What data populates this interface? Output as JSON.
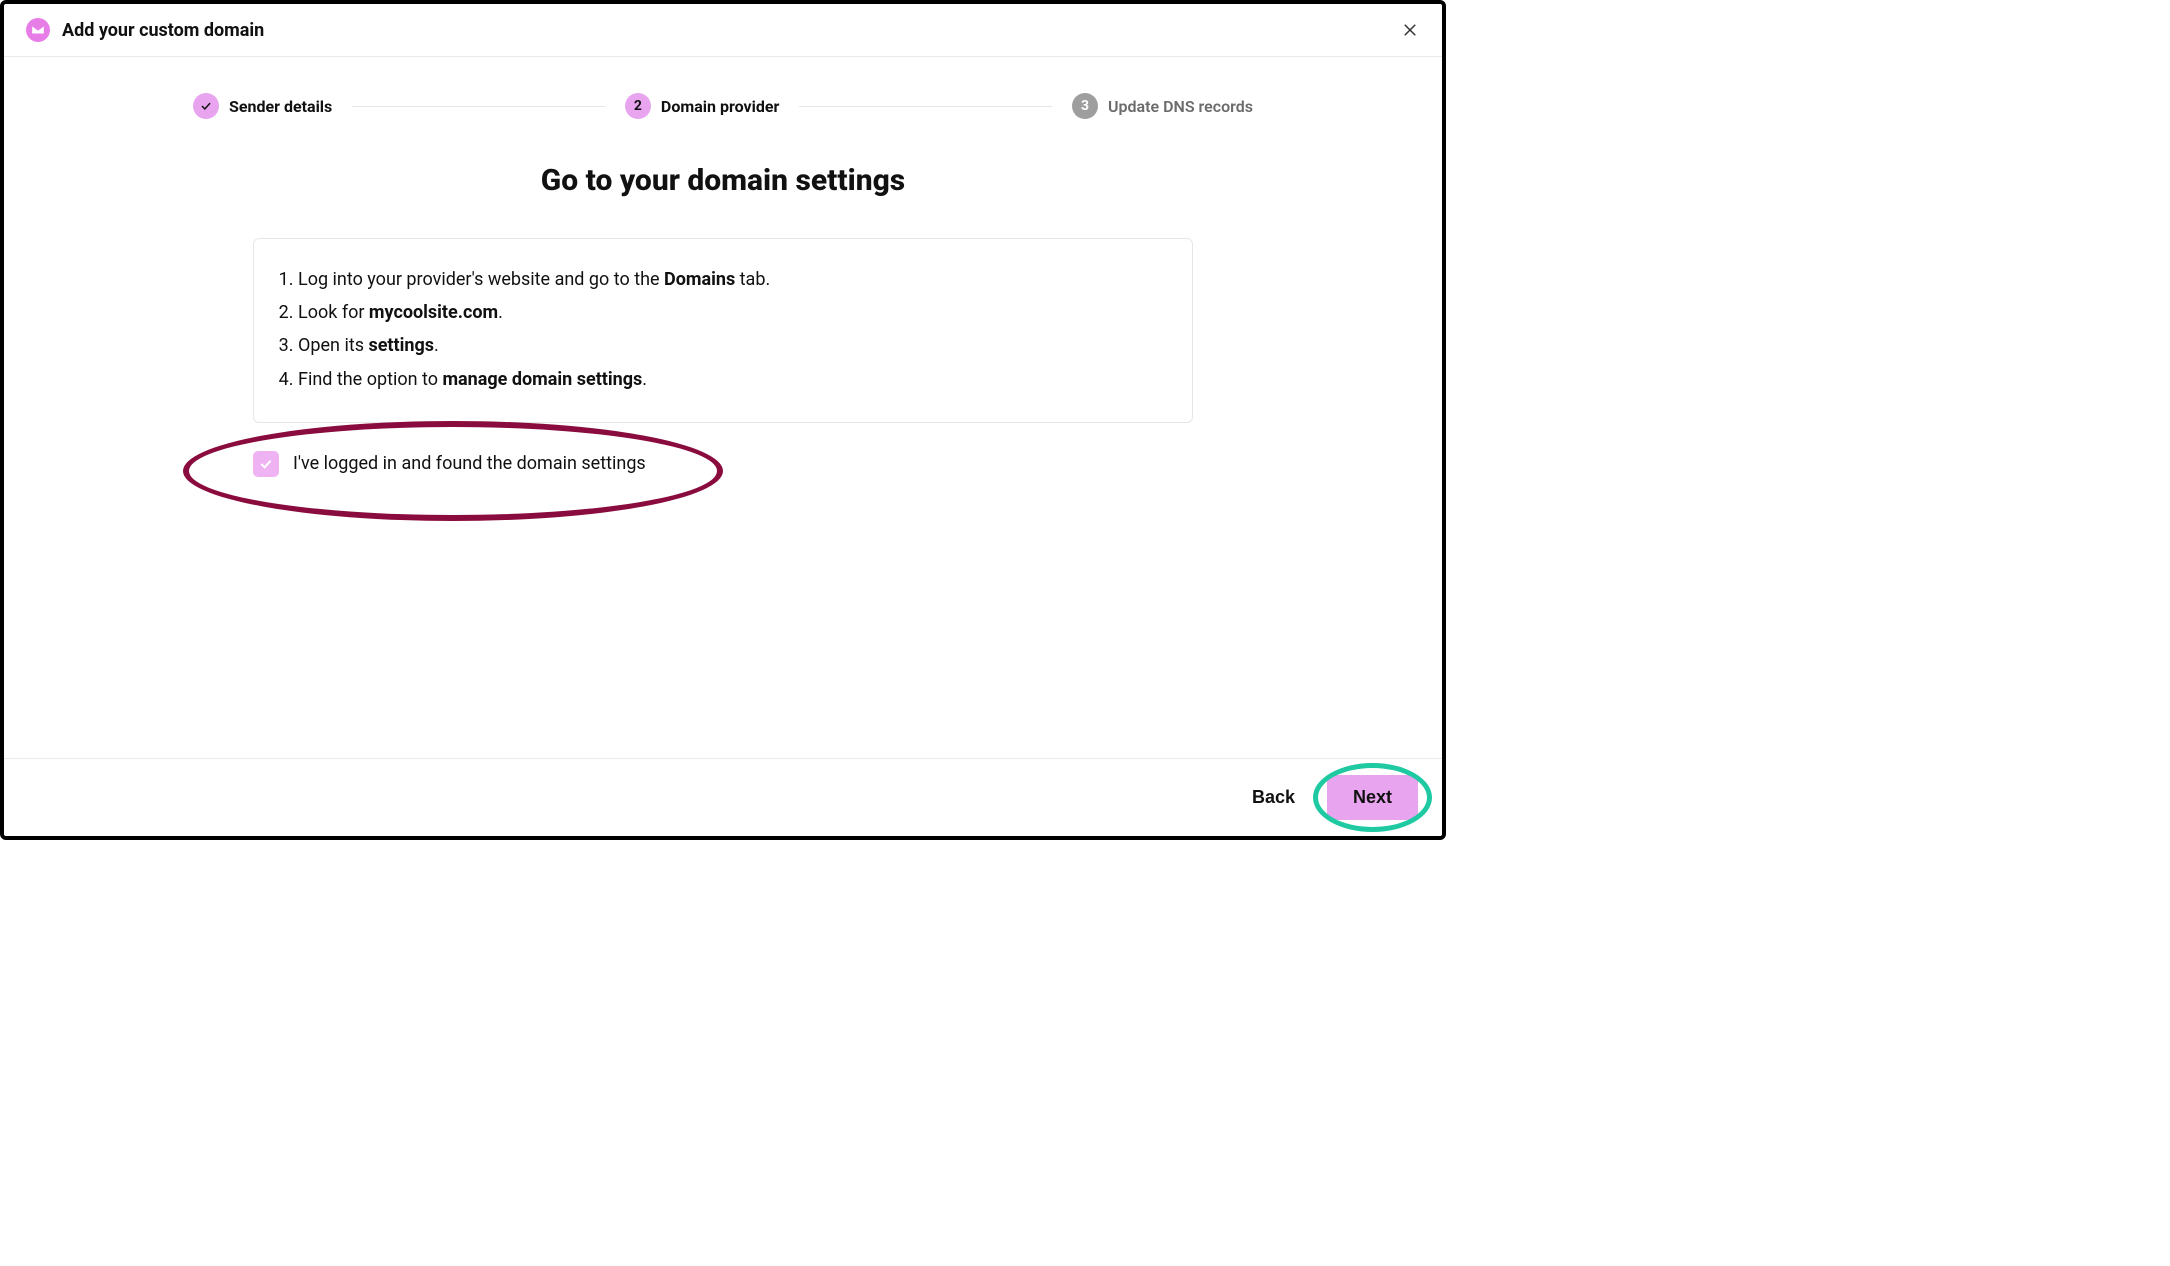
{
  "header": {
    "title": "Add your custom domain"
  },
  "stepper": {
    "steps": [
      {
        "label": "Sender details",
        "state": "done"
      },
      {
        "label": "Domain provider",
        "state": "active",
        "num": "2"
      },
      {
        "label": "Update DNS records",
        "state": "pending",
        "num": "3"
      }
    ]
  },
  "page": {
    "title": "Go to your domain settings"
  },
  "instructions": {
    "step1_pre": "Log into your provider's website and go to the ",
    "step1_bold": "Domains",
    "step1_post": " tab.",
    "step2_pre": "Look for ",
    "step2_bold": "mycoolsite.com",
    "step2_post": ".",
    "step3_pre": "Open its ",
    "step3_bold": "settings",
    "step3_post": ".",
    "step4_pre": "Find the option to ",
    "step4_bold": "manage domain settings",
    "step4_post": "."
  },
  "confirm": {
    "checked": true,
    "label": "I've logged in and found the domain settings"
  },
  "footer": {
    "back": "Back",
    "next": "Next"
  },
  "annotations": {
    "ellipse_confirm_color": "#8a0b3d",
    "ellipse_next_color": "#1fc9a2"
  }
}
